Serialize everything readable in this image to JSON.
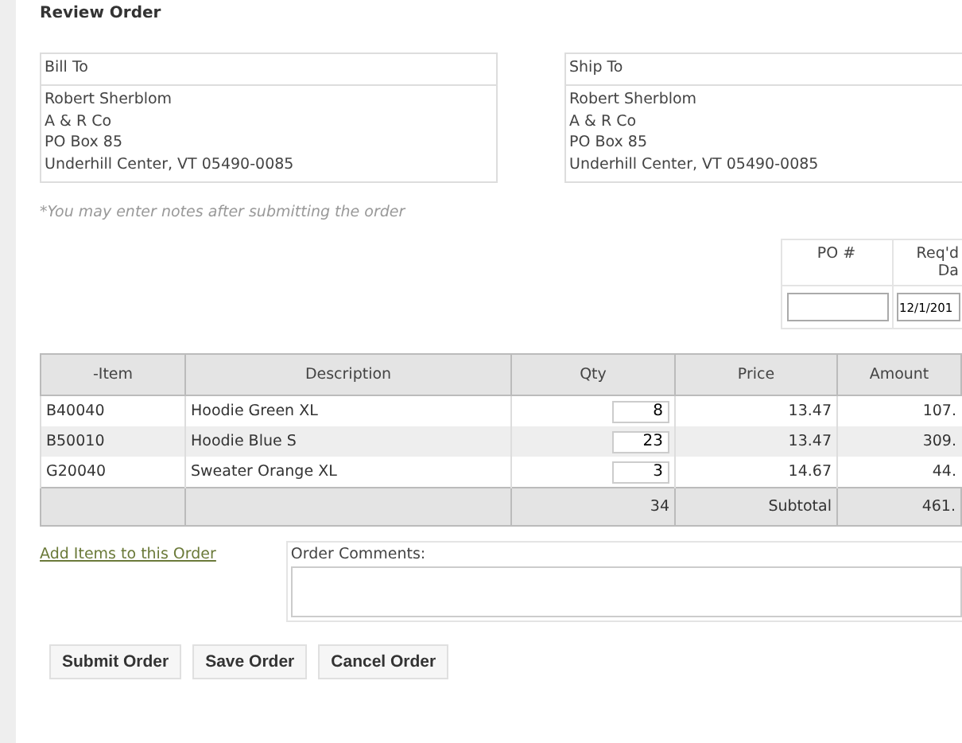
{
  "title": "Review Order",
  "addresses": [
    {
      "heading": "Bill To",
      "lines": [
        "Robert Sherblom",
        "A & R Co",
        "PO Box 85",
        "Underhill Center, VT 05490-0085"
      ]
    },
    {
      "heading": "Ship To",
      "lines": [
        "Robert Sherblom",
        "A & R Co",
        "PO Box 85",
        "Underhill Center, VT 05490-0085"
      ]
    }
  ],
  "note": "*You may enter notes after submitting the order",
  "order_fields": [
    {
      "label": "PO #"
    },
    {
      "label": "Req'd\nDa",
      "value": "12/1/201"
    }
  ],
  "items_table": {
    "columns": [
      "-Item",
      "Description",
      "Qty",
      "Price",
      "Amount"
    ],
    "rows": [
      {
        "item": "B40040",
        "description": "Hoodie Green XL",
        "qty": "8",
        "price": "13.47",
        "amount": "107."
      },
      {
        "item": "B50010",
        "description": "Hoodie Blue S",
        "qty": "23",
        "price": "13.47",
        "amount": "309."
      },
      {
        "item": "G20040",
        "description": "Sweater Orange XL",
        "qty": "3",
        "price": "14.67",
        "amount": "44."
      }
    ],
    "footer": {
      "qty_total": "34",
      "label": "Subtotal",
      "amount": "461."
    }
  },
  "add_items_link": "Add Items to this Order",
  "comments_label": "Order Comments:",
  "buttons": [
    "Submit Order",
    "Save Order",
    "Cancel Order"
  ]
}
